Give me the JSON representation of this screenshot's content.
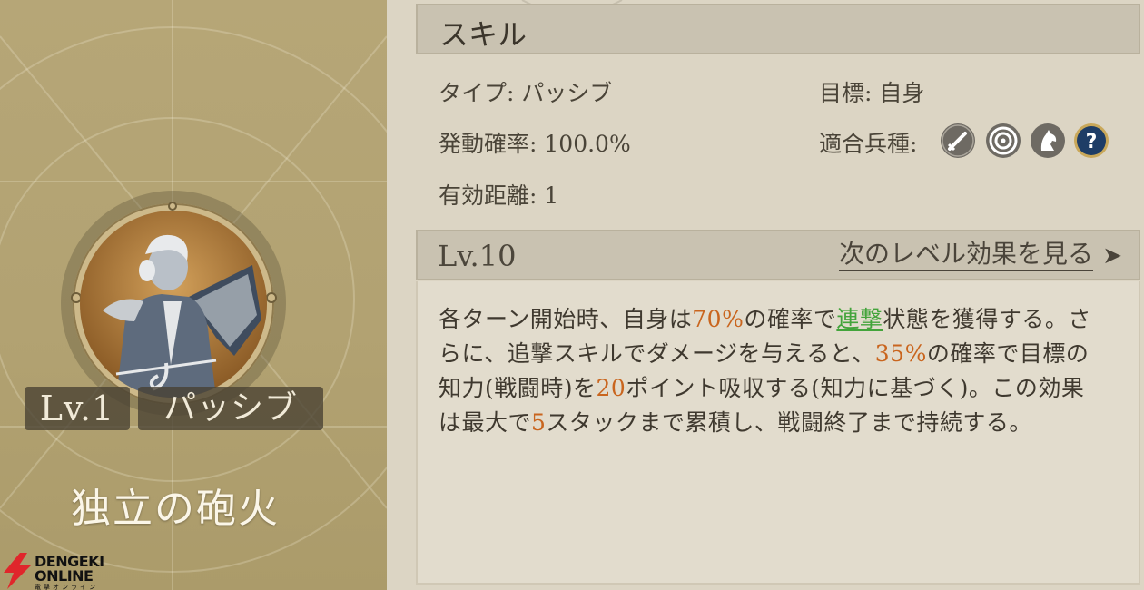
{
  "card": {
    "level_badge": "Lv.1",
    "type_badge": "パッシブ",
    "skill_name": "独立の砲火"
  },
  "logo": {
    "line1": "DENGEKI",
    "line2": "ONLINE",
    "line3": "電撃オンライン"
  },
  "skill_section": {
    "title": "スキル",
    "type_label": "タイプ:",
    "type_value": "パッシブ",
    "target_label": "目標:",
    "target_value": "自身",
    "rate_label": "発動確率:",
    "rate_value": "100.0%",
    "units_label": "適合兵種:",
    "range_label": "有効距離:",
    "range_value": "1",
    "unit_icons": [
      "sword-icon",
      "target-icon",
      "horse-icon",
      "question-icon"
    ]
  },
  "level_section": {
    "title": "Lv.10",
    "next_link": "次のレベル効果を見る",
    "description_parts": [
      {
        "text": "各ターン開始時、自身は",
        "style": "normal"
      },
      {
        "text": "70%",
        "style": "highlight"
      },
      {
        "text": "の確率で",
        "style": "normal"
      },
      {
        "text": "連撃",
        "style": "keyword"
      },
      {
        "text": "状態を獲得する。さらに、追撃スキルでダメージを与えると、",
        "style": "normal"
      },
      {
        "text": "35%",
        "style": "highlight"
      },
      {
        "text": "の確率で目標の知力(戦闘時)を",
        "style": "normal"
      },
      {
        "text": "20",
        "style": "highlight"
      },
      {
        "text": "ポイント吸収する(知力に基づく)。この効果は最大で",
        "style": "normal"
      },
      {
        "text": "5",
        "style": "highlight"
      },
      {
        "text": "スタックまで累積し、戦闘終了まで持続する。",
        "style": "normal"
      }
    ]
  },
  "colors": {
    "highlight": "#c9651e",
    "keyword": "#43a43b",
    "card_bg": "#b2a272"
  }
}
